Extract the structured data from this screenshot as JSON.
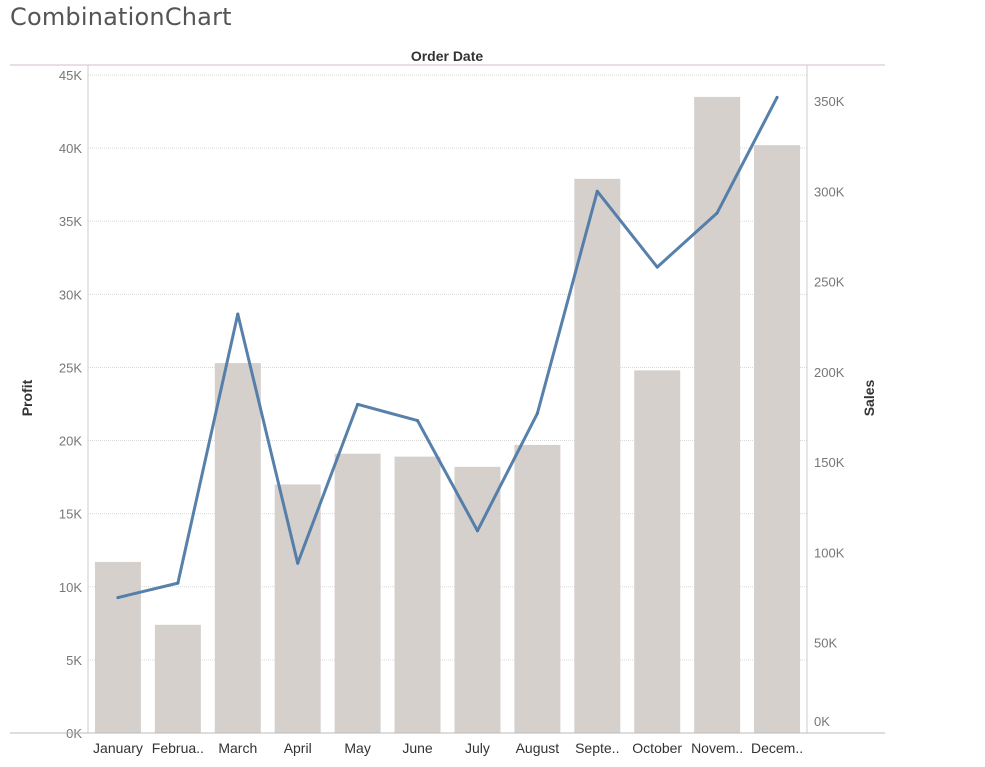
{
  "title": "CombinationChart",
  "chart_data": {
    "type": "bar",
    "title": "CombinationChart",
    "header": "Order Date",
    "categories": [
      "January",
      "February",
      "March",
      "April",
      "May",
      "June",
      "July",
      "August",
      "September",
      "October",
      "November",
      "December"
    ],
    "category_labels": [
      "January",
      "Februa..",
      "March",
      "April",
      "May",
      "June",
      "July",
      "August",
      "Septe..",
      "October",
      "Novem..",
      "Decem.."
    ],
    "series": [
      {
        "name": "Profit",
        "type": "bar",
        "axis": "left",
        "color": "#d6d0cd",
        "values": [
          11700,
          7400,
          25300,
          17000,
          19100,
          18900,
          18200,
          19700,
          37900,
          24800,
          43500,
          40200
        ]
      },
      {
        "name": "Sales",
        "type": "line",
        "axis": "right",
        "color": "#4e79a7",
        "values": [
          75000,
          83000,
          232000,
          94000,
          182000,
          173000,
          112000,
          177000,
          300000,
          258000,
          288000,
          352000
        ]
      }
    ],
    "ylabel": "Profit",
    "ylim": [
      0,
      45000
    ],
    "yticks": [
      "0K",
      "5K",
      "10K",
      "15K",
      "20K",
      "25K",
      "30K",
      "35K",
      "40K",
      "45K"
    ],
    "y2label": "Sales",
    "y2lim": [
      0,
      350000
    ],
    "y2ticks": [
      "0K",
      "50K",
      "100K",
      "150K",
      "200K",
      "250K",
      "300K",
      "350K"
    ],
    "grid": true
  }
}
